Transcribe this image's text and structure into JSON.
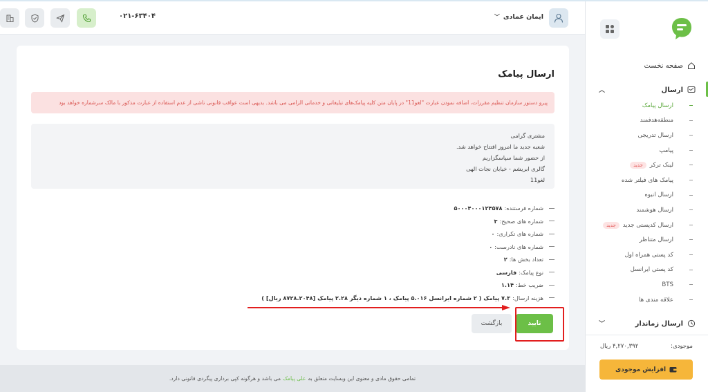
{
  "sidebar": {
    "home": "صفحه نخست",
    "send_section": "ارسال",
    "items": [
      {
        "label": "ارسال پیامک",
        "active": true
      },
      {
        "label": "منطقه‌هدفمند"
      },
      {
        "label": "ارسال تدریجی"
      },
      {
        "label": "پیامپ"
      },
      {
        "label": "لینک ترکر",
        "badge": "جدید"
      },
      {
        "label": "پیامک های فیلتر شده"
      },
      {
        "label": "ارسال انبوه"
      },
      {
        "label": "ارسال هوشمند"
      },
      {
        "label": "ارسال کدپستی جدید",
        "badge": "جدید"
      },
      {
        "label": "ارسال متناظر"
      },
      {
        "label": "کد پستی همراه اول"
      },
      {
        "label": "کد پستی ایرانسل"
      },
      {
        "label": "BTS"
      },
      {
        "label": "علاقه مندی ها"
      }
    ],
    "scheduled": "ارسال زماندار",
    "balance_label": "موجودی:",
    "balance_value": "۴,۲۷۰,۳۹۲ ریال",
    "charge_button": "افزایش موجودی"
  },
  "header": {
    "user_name": "ایمان عمادی",
    "phone": "۰۲۱-۶۳۴۰۴"
  },
  "card": {
    "title": "ارسال پیامک",
    "alert": "پیرو دستور سازمان تنظیم مقررات، اضافه نمودن عبارت \"لغو11\" در پایان متن کلیه پیامک‌های تبلیغاتی و خدماتی الزامی می باشد. بدیهی است عواقب قانونی ناشی از عدم استفاده از عبارت مذکور با مالک سرشماره خواهد بود",
    "message_lines": [
      "مشتری گرامی",
      "شعبه جدید ما امروز افتتاح خواهد شد.",
      "از حضور شما سپاسگزاریم",
      "گالری ابریشم - خیابان نجات الهی",
      "لغو11"
    ],
    "details": [
      {
        "label": "شماره فرستنده:",
        "value": "۵۰۰۰۴۰۰۰۱۲۴۵۷۸"
      },
      {
        "label": "شماره های صحیح:",
        "value": "۳"
      },
      {
        "label": "شماره های تکراری:",
        "value": "۰"
      },
      {
        "label": "شماره های نادرست:",
        "value": "۰"
      },
      {
        "label": "تعداد بخش ها:",
        "value": "۲"
      },
      {
        "label": "نوع پیامک:",
        "value": "فارسی"
      },
      {
        "label": "ضریب خط:",
        "value": "۱.۱۴"
      },
      {
        "label": "هزینه ارسال:",
        "value": "۷.۳ پیامک ( ۲ شماره ایرانسل ۵.۰۱۶ پیامک ، ۱ شماره دیگر ۲.۲۸ پیامک [۸۷۲۸.۲۰۴۸ ریال] )"
      }
    ],
    "confirm_button": "تایید",
    "back_button": "بازگشت"
  },
  "footer": {
    "text_before": "تمامی حقوق مادی و معنوی این وبسایت متعلق به",
    "brand": "علی پیامک",
    "text_after": "می باشد و هرگونه کپی برداری پیگردی قانونی دارد."
  },
  "colors": {
    "accent_green": "#6cbf47",
    "alert_bg": "#fbe1e1",
    "alert_text": "#d9534f",
    "charge_orange": "#f6b63a",
    "annotation_red": "#e21e1e"
  }
}
